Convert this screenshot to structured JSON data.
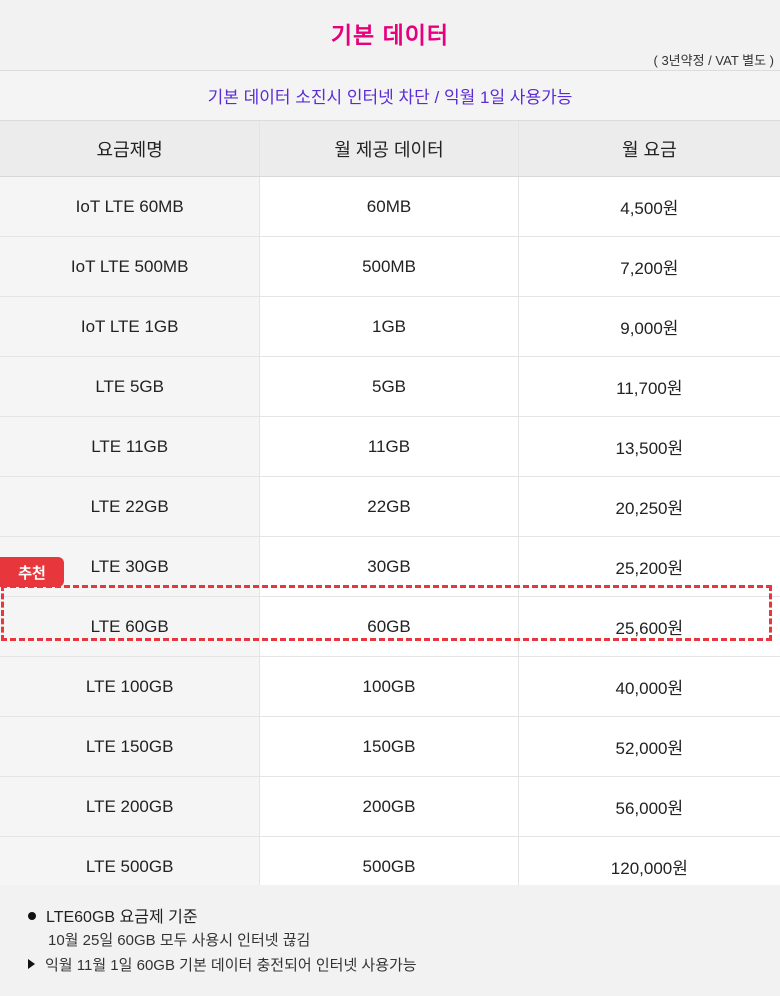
{
  "header": {
    "title": "기본 데이터",
    "note": "( 3년약정 / VAT 별도 )",
    "subtitle": "기본 데이터 소진시 인터넷 차단 / 익월 1일 사용가능"
  },
  "table": {
    "columns": [
      "요금제명",
      "월 제공 데이터",
      "월 요금"
    ],
    "rows": [
      [
        "IoT LTE 60MB",
        "60MB",
        "4,500원"
      ],
      [
        "IoT LTE 500MB",
        "500MB",
        "7,200원"
      ],
      [
        "IoT LTE 1GB",
        "1GB",
        "9,000원"
      ],
      [
        "LTE 5GB",
        "5GB",
        "11,700원"
      ],
      [
        "LTE 11GB",
        "11GB",
        "13,500원"
      ],
      [
        "LTE 22GB",
        "22GB",
        "20,250원"
      ],
      [
        "LTE 30GB",
        "30GB",
        "25,200원"
      ],
      [
        "LTE 60GB",
        "60GB",
        "25,600원"
      ],
      [
        "LTE 100GB",
        "100GB",
        "40,000원"
      ],
      [
        "LTE 150GB",
        "150GB",
        "52,000원"
      ],
      [
        "LTE 200GB",
        "200GB",
        "56,000원"
      ],
      [
        "LTE 500GB",
        "500GB",
        "120,000원"
      ]
    ]
  },
  "recommend": {
    "badge": "추천",
    "color": "#e8373c"
  },
  "footer": {
    "line1": "LTE60GB 요금제 기준",
    "line2": "10월 25일 60GB 모두 사용시 인터넷 끊김",
    "line3": "익월 11월 1일 60GB 기본 데이터 충전되어 인터넷 사용가능"
  },
  "colors": {
    "title": "#e6007e",
    "subtitle": "#5b2bd6"
  }
}
